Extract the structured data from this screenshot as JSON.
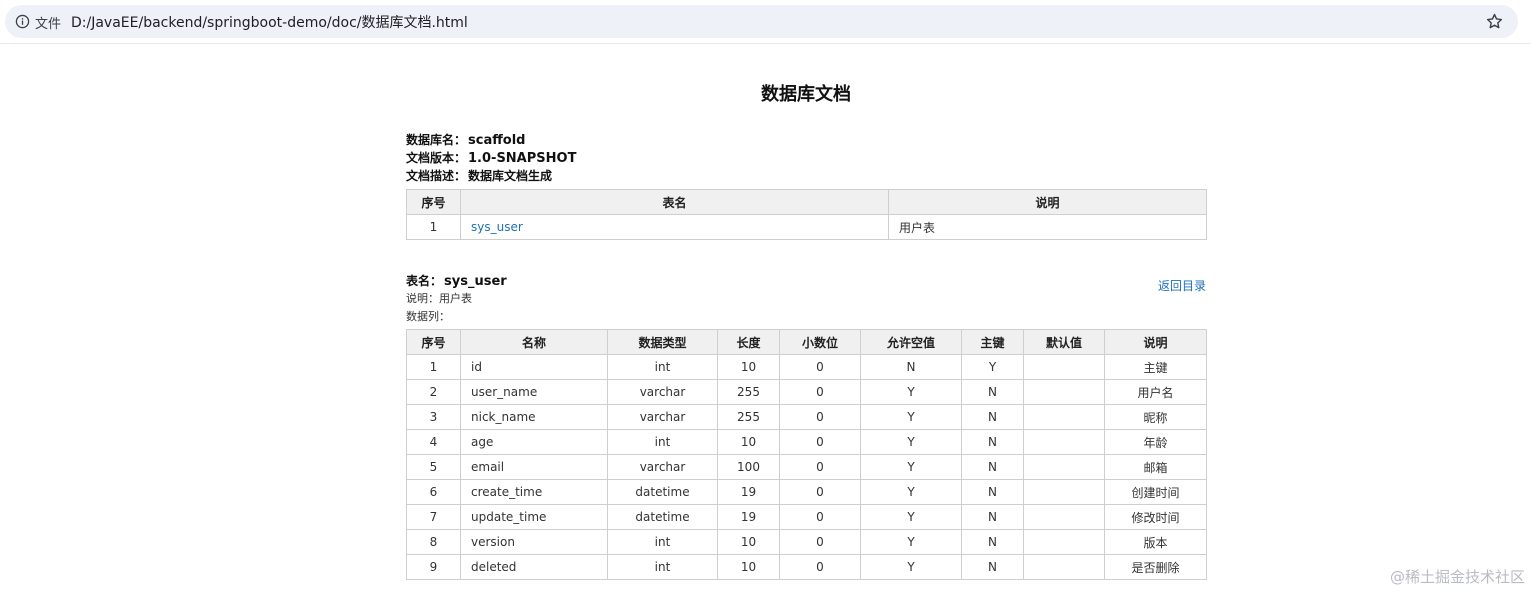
{
  "browser": {
    "file_label": "文件",
    "url": "D:/JavaEE/backend/springboot-demo/doc/数据库文档.html"
  },
  "doc": {
    "title": "数据库文档",
    "meta": [
      {
        "key": "数据库名：",
        "value": "scaffold"
      },
      {
        "key": "文档版本：",
        "value": "1.0-SNAPSHOT"
      },
      {
        "key": "文档描述：",
        "value": "数据库文档生成"
      }
    ],
    "index_table": {
      "headers": [
        "序号",
        "表名",
        "说明"
      ],
      "rows": [
        {
          "no": "1",
          "name": "sys_user",
          "desc": "用户表"
        }
      ]
    },
    "table_section": {
      "name_label": "表名：",
      "name_value": "sys_user",
      "desc_line": "说明：用户表",
      "cols_line": "数据列：",
      "back_link": "返回目录",
      "headers": [
        "序号",
        "名称",
        "数据类型",
        "长度",
        "小数位",
        "允许空值",
        "主键",
        "默认值",
        "说明"
      ],
      "rows": [
        [
          "1",
          "id",
          "int",
          "10",
          "0",
          "N",
          "Y",
          "",
          "主键"
        ],
        [
          "2",
          "user_name",
          "varchar",
          "255",
          "0",
          "Y",
          "N",
          "",
          "用户名"
        ],
        [
          "3",
          "nick_name",
          "varchar",
          "255",
          "0",
          "Y",
          "N",
          "",
          "昵称"
        ],
        [
          "4",
          "age",
          "int",
          "10",
          "0",
          "Y",
          "N",
          "",
          "年龄"
        ],
        [
          "5",
          "email",
          "varchar",
          "100",
          "0",
          "Y",
          "N",
          "",
          "邮箱"
        ],
        [
          "6",
          "create_time",
          "datetime",
          "19",
          "0",
          "Y",
          "N",
          "",
          "创建时间"
        ],
        [
          "7",
          "update_time",
          "datetime",
          "19",
          "0",
          "Y",
          "N",
          "",
          "修改时间"
        ],
        [
          "8",
          "version",
          "int",
          "10",
          "0",
          "Y",
          "N",
          "",
          "版本"
        ],
        [
          "9",
          "deleted",
          "int",
          "10",
          "0",
          "Y",
          "N",
          "",
          "是否删除"
        ]
      ]
    }
  },
  "watermark": "@稀土掘金技术社区",
  "colors": {
    "link": "#1e6fb8",
    "header_bg": "#f0f0f0",
    "omnibox_bg": "#eef1f8"
  },
  "icons": {
    "info": "info-icon",
    "star": "star-icon"
  }
}
